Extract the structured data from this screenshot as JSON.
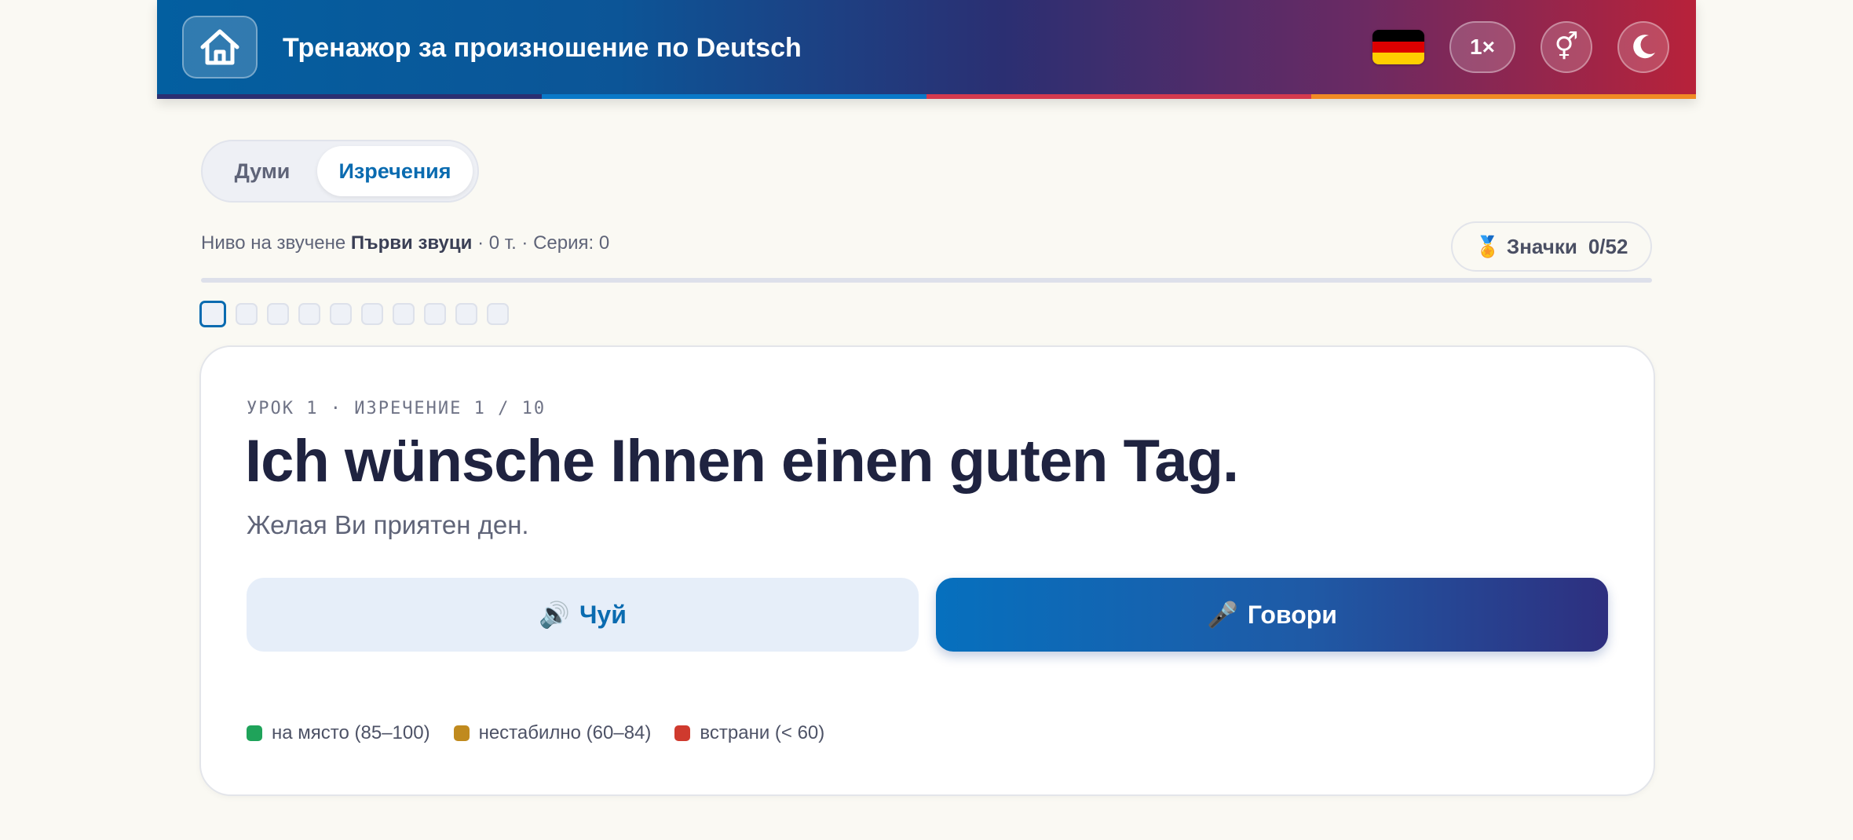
{
  "header": {
    "title": "Тренажор за произношение по Deutsch",
    "speed_label": "1×",
    "gender_symbol": "⚥",
    "theme_icon": "moon-icon",
    "home_icon": "home-icon",
    "flag_colors": [
      "#000000",
      "#dd0000",
      "#ffce00"
    ],
    "stripe_colors": [
      "#2b2f72",
      "#0a79c8",
      "#d43a4e",
      "#f08a24"
    ]
  },
  "tabs": {
    "words_label": "Думи",
    "phrases_label": "Изречения",
    "active": "phrases"
  },
  "status": {
    "level_prefix": "Ниво на звучене",
    "level_name": "Първи звуци",
    "points": "· 0 т. · Серия: 0"
  },
  "badges": {
    "icon": "🏅",
    "label": "Значки",
    "count": "0/52"
  },
  "progress": {
    "current_index": 1,
    "total": 10
  },
  "card": {
    "meta": "УРОК 1 · ИЗРЕЧЕНИЕ 1 / 10",
    "phrase": "Ich wünsche Ihnen einen guten Tag.",
    "translation": "Желая Ви приятен ден.",
    "listen_icon": "🔊",
    "listen_label": "Чуй",
    "speak_icon": "🎤",
    "speak_label": "Говори"
  },
  "legend": [
    {
      "label": "на място (85–100)",
      "color": "#1fa35a"
    },
    {
      "label": "нестабилно (60–84)",
      "color": "#c08a1e"
    },
    {
      "label": "встрани (< 60)",
      "color": "#cf3a2e"
    }
  ]
}
